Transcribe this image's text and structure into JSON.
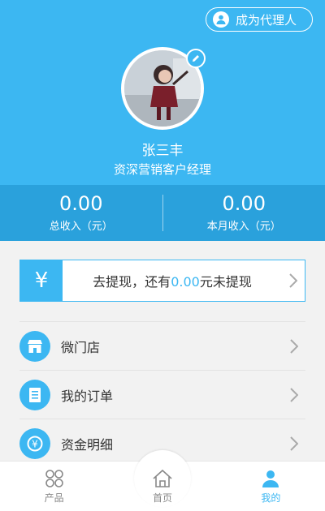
{
  "header": {
    "agent_button_label": "成为代理人",
    "user_name": "张三丰",
    "user_title": "资深营销客户经理"
  },
  "stats": [
    {
      "value": "0.00",
      "label": "总收入（元）"
    },
    {
      "value": "0.00",
      "label": "本月收入（元）"
    }
  ],
  "withdraw": {
    "icon": "yuan-icon",
    "text_before": "去提现，还有",
    "amount": "0.00",
    "text_after": "元未提现"
  },
  "menu": [
    {
      "label": "微门店",
      "icon": "store-icon"
    },
    {
      "label": "我的订单",
      "icon": "order-icon"
    },
    {
      "label": "资金明细",
      "icon": "funds-icon"
    }
  ],
  "tabbar": [
    {
      "label": "产品",
      "icon": "grid-icon"
    },
    {
      "label": "首页",
      "icon": "home-icon"
    },
    {
      "label": "我的",
      "icon": "user-icon",
      "active": true
    }
  ],
  "colors": {
    "primary": "#3cb7f2",
    "primary_dark": "#2aa1dc",
    "background": "#f2f2f2"
  }
}
